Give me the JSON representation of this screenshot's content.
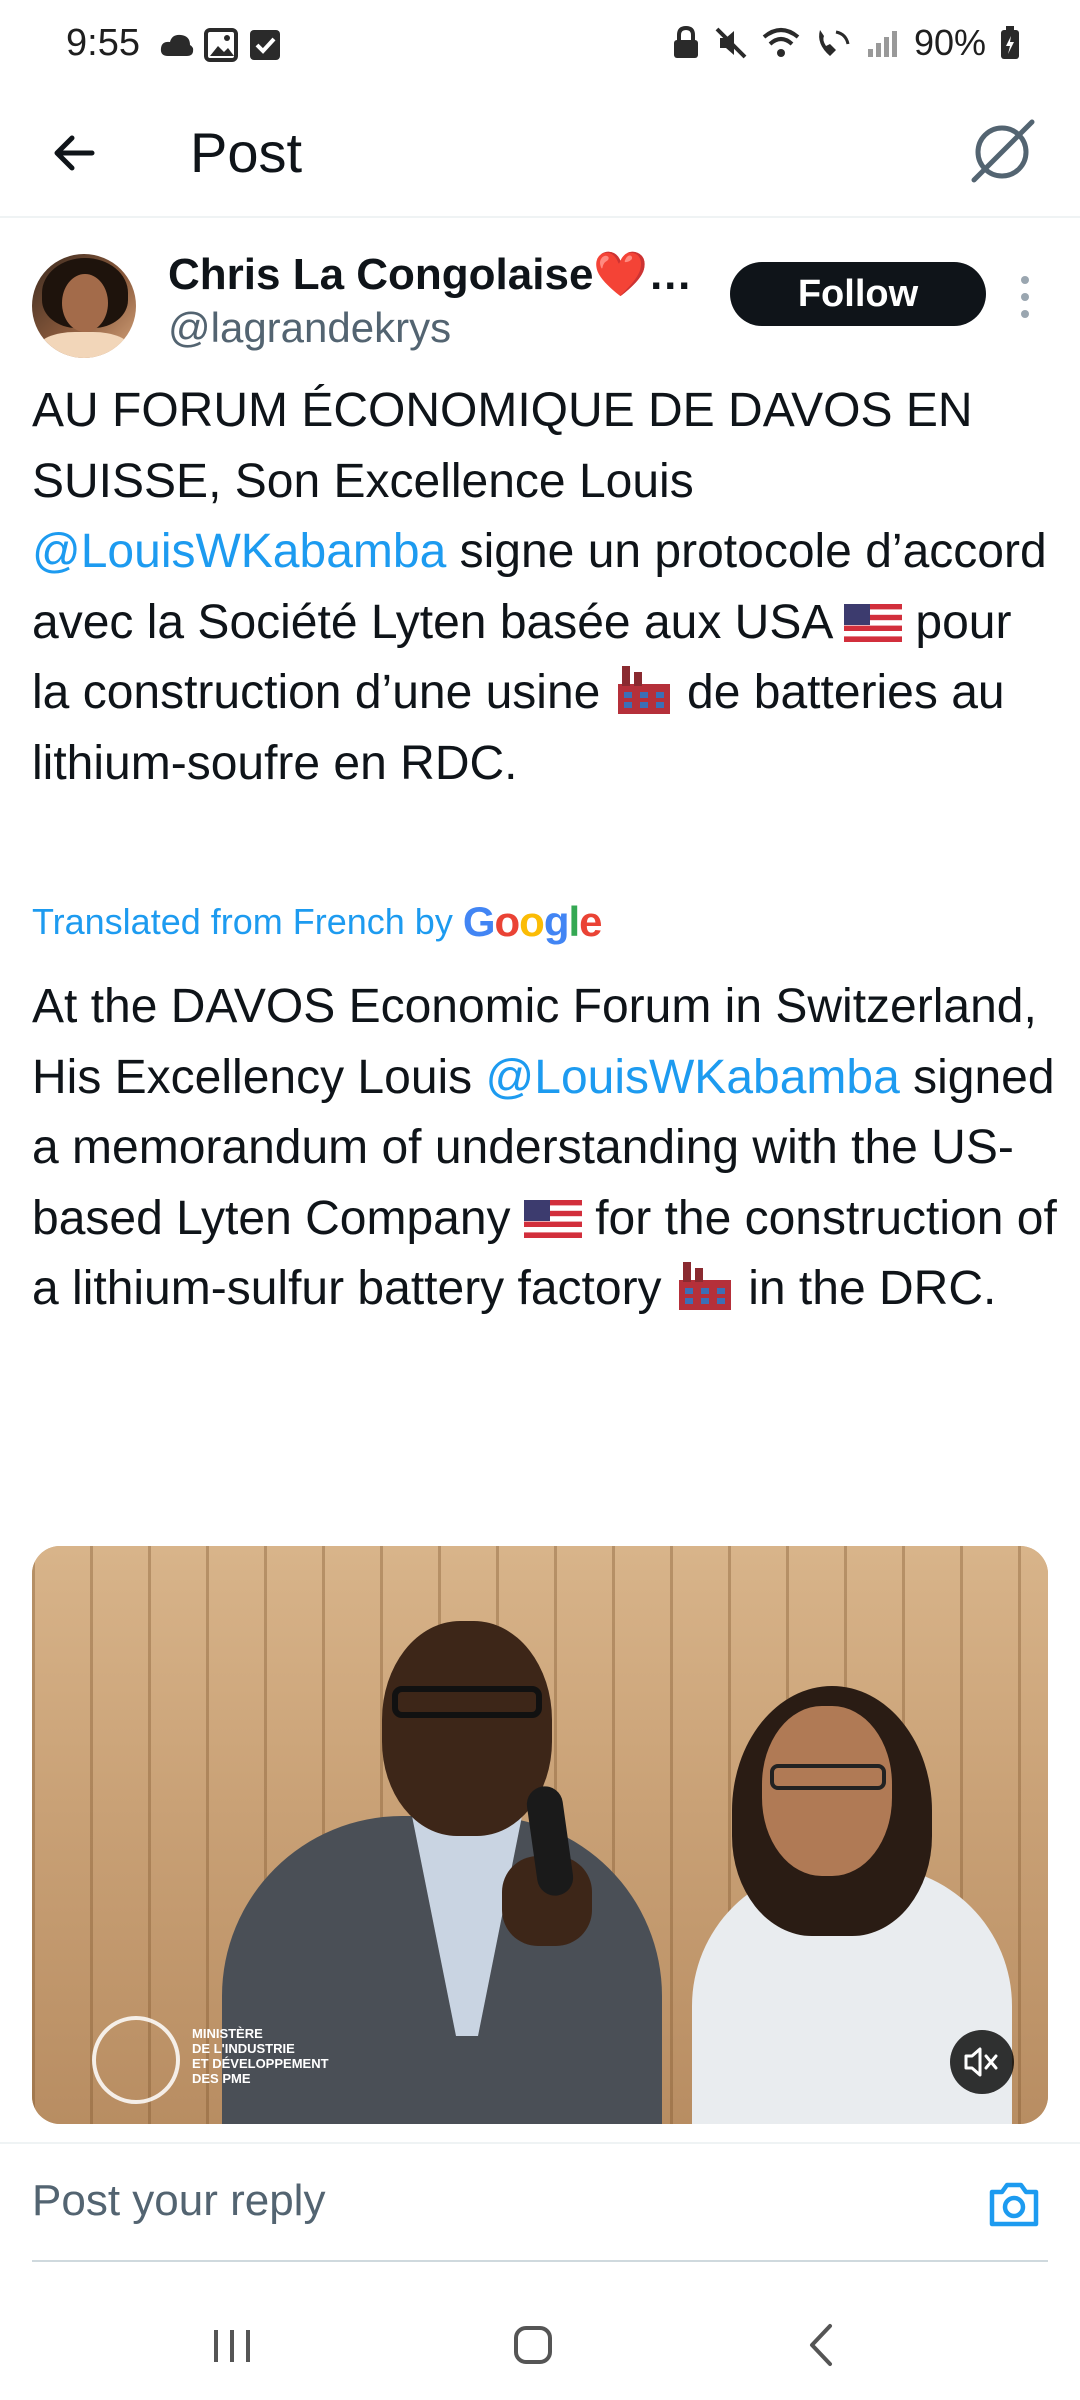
{
  "status_bar": {
    "time": "9:55",
    "battery": "90%",
    "left_icons": [
      "cloud-icon",
      "image-icon",
      "checkbox-icon"
    ],
    "right_icons": [
      "lock-icon",
      "mute-icon",
      "wifi-icon",
      "wifi-call-icon",
      "signal-icon",
      "battery-icon"
    ]
  },
  "header": {
    "title": "Post",
    "back_icon": "arrow-left-icon",
    "grok_icon": "grok-icon"
  },
  "post": {
    "author": {
      "display_name": "Chris La Congolaise❤️…",
      "handle": "@lagrandekrys"
    },
    "follow_label": "Follow",
    "original_text": {
      "part1": "AU FORUM ÉCONOMIQUE DE DAVOS EN SUISSE, Son Excellence Louis ",
      "mention": "@LouisWKabamba",
      "part2": "  signe un protocole d’accord avec la Société Lyten  basée aux USA ",
      "part3": " pour la construction d’une usine ",
      "part4": " de batteries au lithium-soufre en RDC."
    },
    "translated_label": "Translated from French by",
    "translation_provider": {
      "G": "G",
      "o1": "o",
      "o2": "o",
      "g": "g",
      "l": "l",
      "e": "e"
    },
    "translated_text": {
      "part1": "At the DAVOS Economic Forum in Switzerland, His Excellency Louis ",
      "mention": "@LouisWKabamba",
      "part2": " signed a memorandum of understanding with the US-based Lyten Company ",
      "part3": " for the construction of a lithium-sulfur battery factory ",
      "part4": " in the DRC."
    },
    "media": {
      "watermark": [
        "MINISTÈRE",
        "DE L'INDUSTRIE",
        "ET DÉVELOPPEMENT",
        "DES PME"
      ],
      "mute_icon": "volume-mute-icon"
    }
  },
  "reply": {
    "placeholder": "Post your reply",
    "camera_icon": "camera-icon"
  },
  "nav_bar": {
    "icons": [
      "recents-icon",
      "home-icon",
      "back-icon"
    ]
  },
  "colors": {
    "accent": "#1d9bf0",
    "text": "#0f1419",
    "muted": "#536471",
    "follow_bg": "#0f1419"
  }
}
